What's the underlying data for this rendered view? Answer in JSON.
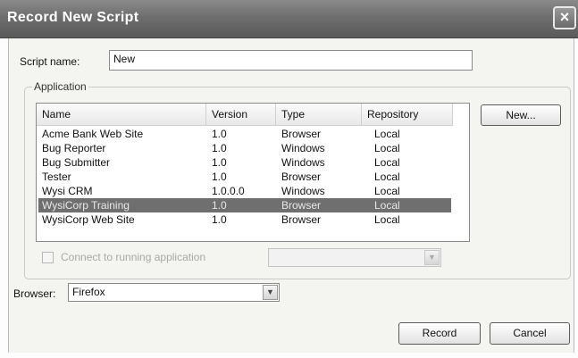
{
  "window": {
    "title": "Record New Script",
    "close_glyph": "×"
  },
  "script_name": {
    "label": "Script name:",
    "value": "New"
  },
  "application_group": {
    "title": "Application"
  },
  "app_list": {
    "columns": [
      "Name",
      "Version",
      "Type",
      "Repository"
    ],
    "rows": [
      {
        "name": "Acme Bank Web Site",
        "version": "1.0",
        "type": "Browser",
        "repository": "Local"
      },
      {
        "name": "Bug Reporter",
        "version": "1.0",
        "type": "Windows",
        "repository": "Local"
      },
      {
        "name": "Bug Submitter",
        "version": "1.0",
        "type": "Windows",
        "repository": "Local"
      },
      {
        "name": "Tester",
        "version": "1.0",
        "type": "Browser",
        "repository": "Local"
      },
      {
        "name": "Wysi CRM",
        "version": "1.0.0.0",
        "type": "Windows",
        "repository": "Local"
      },
      {
        "name": "WysiCorp Training",
        "version": "1.0",
        "type": "Browser",
        "repository": "Local"
      },
      {
        "name": "WysiCorp Web Site",
        "version": "1.0",
        "type": "Browser",
        "repository": "Local"
      }
    ],
    "selected_index": 5
  },
  "new_button": {
    "label": "New..."
  },
  "connect": {
    "label": "Connect to running application",
    "checked": false,
    "enabled": false
  },
  "process_combo": {
    "value": ""
  },
  "browser": {
    "label": "Browser:",
    "value": "Firefox"
  },
  "record_button": {
    "label": "Record"
  },
  "cancel_button": {
    "label": "Cancel"
  },
  "icons": {
    "close": "close-icon",
    "dropdown": "chevron-down-icon"
  }
}
